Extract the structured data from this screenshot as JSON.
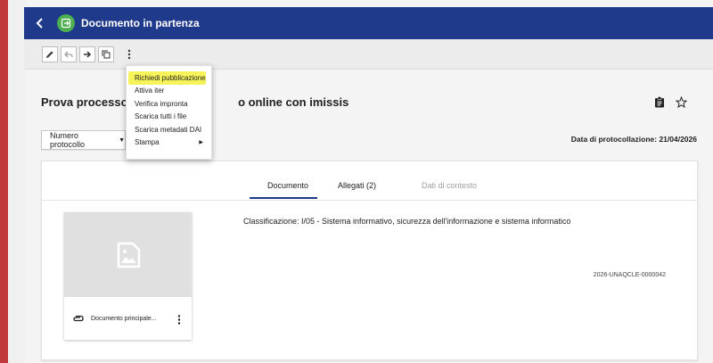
{
  "colors": {
    "header": "#1f3a8a",
    "accent_bar": "#c0393d",
    "highlight": "#f6f45a",
    "app_icon": "#4caf50"
  },
  "header": {
    "title": "Documento in partenza",
    "back_icon": "chevron-left-icon",
    "app_icon": "exit-box-icon"
  },
  "toolbar": {
    "icons": [
      "pencil-icon",
      "reply-icon",
      "forward-arrow-icon",
      "copy-icon",
      "more-vertical-icon"
    ]
  },
  "document": {
    "title": "Prova processo di                              o online con imissis",
    "protocol_button": "Numero protocollo",
    "protocol_date": "Data di protocollazione: 21/04/2026"
  },
  "menu": {
    "items": [
      {
        "label": "Richiedi pubblicazione"
      },
      {
        "label": "Attiva iter"
      },
      {
        "label": "Verifica impronta"
      },
      {
        "label": "Scarica tutti i file"
      },
      {
        "label": "Scarica metadati DAI"
      },
      {
        "label": "Stampa"
      }
    ]
  },
  "tabs": [
    {
      "label": "Documento"
    },
    {
      "label": "Allegati (2)"
    },
    {
      "label": "Dati di contesto"
    }
  ],
  "content": {
    "classification": "Classificazione:  I/05 - Sistema informativo, sicurezza dell'informazione e sistema informatico",
    "code": "2026-UNAQCLE-0000042",
    "preview_name": "Documento principale..."
  }
}
